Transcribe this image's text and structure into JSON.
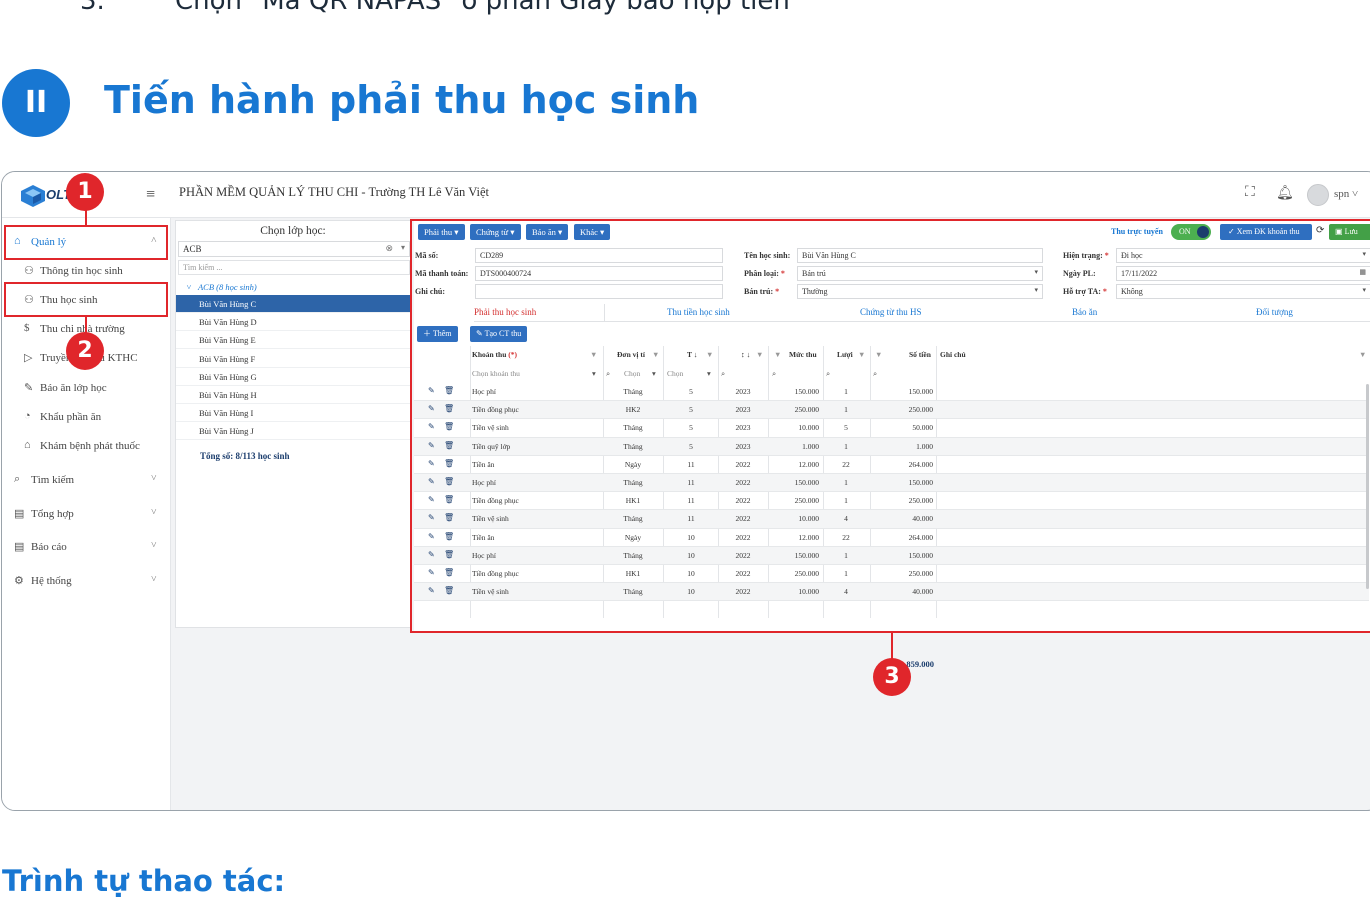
{
  "top_step": {
    "number": "3.",
    "text": "Chọn \"Mã QR NAPAS\" ở phần Giấy báo nộp tiền"
  },
  "section": {
    "badge": "II",
    "title": "Tiến hành phải thu học sinh"
  },
  "bottom_heading": "Trình tự thao tác:",
  "app": {
    "logo_text": "OLT",
    "title": "PHẦN MỀM QUẢN LÝ THU CHI - Trường TH Lê Văn Việt",
    "user": "spn"
  },
  "sidebar": {
    "items": [
      {
        "label": "Quản lý",
        "icon": "home-icon",
        "level": "top",
        "active": true,
        "chevron": "˄"
      },
      {
        "label": "Thông tin học sinh",
        "icon": "users-icon",
        "level": "sub"
      },
      {
        "label": "Thu học sinh",
        "icon": "users-icon",
        "level": "sub"
      },
      {
        "label": "Thu chi nhà trường",
        "icon": "coin-icon",
        "level": "sub"
      },
      {
        "label": "Truyền dữ liệu KTHC",
        "icon": "send-icon",
        "level": "sub"
      },
      {
        "label": "Báo ăn lớp học",
        "icon": "edit-icon",
        "level": "sub"
      },
      {
        "label": "Khẩu phần ăn",
        "icon": "meal-icon",
        "level": "sub"
      },
      {
        "label": "Khám bệnh phát thuốc",
        "icon": "clinic-icon",
        "level": "sub"
      },
      {
        "label": "Tìm kiếm",
        "icon": "search-icon",
        "level": "top",
        "chevron": "˅"
      },
      {
        "label": "Tổng hợp",
        "icon": "clipboard-icon",
        "level": "top",
        "chevron": "˅"
      },
      {
        "label": "Báo cáo",
        "icon": "report-icon",
        "level": "top",
        "chevron": "˅"
      },
      {
        "label": "Hệ thống",
        "icon": "settings-icon",
        "level": "top",
        "chevron": "˅"
      }
    ]
  },
  "class_panel": {
    "heading": "Chọn lớp học:",
    "selected_class": "ACB",
    "search_placeholder": "Tìm kiếm ...",
    "group_label": "ACB (8 học sinh)",
    "students": [
      "Bùi Văn Hùng C",
      "Bùi Văn Hùng D",
      "Bùi Văn Hùng E",
      "Bùi Văn Hùng F",
      "Bùi Văn Hùng G",
      "Bùi Văn Hùng H",
      "Bùi Văn Hùng I",
      "Bùi Văn Hùng J"
    ],
    "selected_index": 0,
    "total": "Tổng số: 8/113 học sinh"
  },
  "toolbar": {
    "menus": [
      "Phải thu ▾",
      "Chứng từ ▾",
      "Báo ăn ▾",
      "Khác ▾"
    ],
    "online_label": "Thu trực tuyến",
    "toggle": "ON",
    "view_button": "Xem ĐK khoản thu",
    "save_button": "Lưu"
  },
  "form": {
    "ma_so": {
      "label": "Mã số:",
      "value": "CD289"
    },
    "ma_thanh_toan": {
      "label": "Mã thanh toán:",
      "value": "DTS000400724"
    },
    "ghi_chu": {
      "label": "Ghi chú:",
      "value": ""
    },
    "ten_hoc_sinh": {
      "label": "Tên học sinh:",
      "value": "Bùi Văn Hùng C"
    },
    "phan_loai": {
      "label": "Phân loại:",
      "value": "Bán trú"
    },
    "ban_tru": {
      "label": "Bán trú:",
      "value": "Thường"
    },
    "hien_trang": {
      "label": "Hiện trạng:",
      "value": "Đi học"
    },
    "ngay_pl": {
      "label": "Ngày PL:",
      "value": "17/11/2022"
    },
    "ho_tro_ta": {
      "label": "Hỗ trợ TA:",
      "value": "Không"
    }
  },
  "tabs": [
    "Phải thu học sinh",
    "Thu tiền học sinh",
    "Chứng từ thu HS",
    "Báo ăn",
    "Đối tượng"
  ],
  "actions": {
    "add": "Thêm",
    "create": "Tạo CT thu"
  },
  "grid": {
    "headers": [
      "Khoản thu",
      "Đơn vị tí",
      "T",
      "N",
      "Mức thu",
      "Lượi",
      "Số tiền",
      "Ghi chú"
    ],
    "filters": {
      "khoan_thu": "Chọn khoản thu",
      "don_vi": "Chọn",
      "t": "Chọn"
    },
    "rows": [
      [
        "Học phí",
        "Tháng",
        "5",
        "2023",
        "150.000",
        "1",
        "150.000"
      ],
      [
        "Tiền đồng phục",
        "HK2",
        "5",
        "2023",
        "250.000",
        "1",
        "250.000"
      ],
      [
        "Tiền vệ sinh",
        "Tháng",
        "5",
        "2023",
        "10.000",
        "5",
        "50.000"
      ],
      [
        "Tiền quỹ lớp",
        "Tháng",
        "5",
        "2023",
        "1.000",
        "1",
        "1.000"
      ],
      [
        "Tiền ăn",
        "Ngày",
        "11",
        "2022",
        "12.000",
        "22",
        "264.000"
      ],
      [
        "Học phí",
        "Tháng",
        "11",
        "2022",
        "150.000",
        "1",
        "150.000"
      ],
      [
        "Tiền đồng phục",
        "HK1",
        "11",
        "2022",
        "250.000",
        "1",
        "250.000"
      ],
      [
        "Tiền vệ sinh",
        "Tháng",
        "11",
        "2022",
        "10.000",
        "4",
        "40.000"
      ],
      [
        "Tiền ăn",
        "Ngày",
        "10",
        "2022",
        "12.000",
        "22",
        "264.000"
      ],
      [
        "Học phí",
        "Tháng",
        "10",
        "2022",
        "150.000",
        "1",
        "150.000"
      ],
      [
        "Tiền đồng phục",
        "HK1",
        "10",
        "2022",
        "250.000",
        "1",
        "250.000"
      ],
      [
        "Tiền vệ sinh",
        "Tháng",
        "10",
        "2022",
        "10.000",
        "4",
        "40.000"
      ]
    ],
    "total": "1.859.000"
  },
  "callouts": [
    "1",
    "2",
    "3"
  ],
  "colors": {
    "accent": "#1877d2",
    "annotation_red": "#e0262b",
    "toolbar_blue": "#2f6fc0",
    "save_green": "#43a047"
  }
}
